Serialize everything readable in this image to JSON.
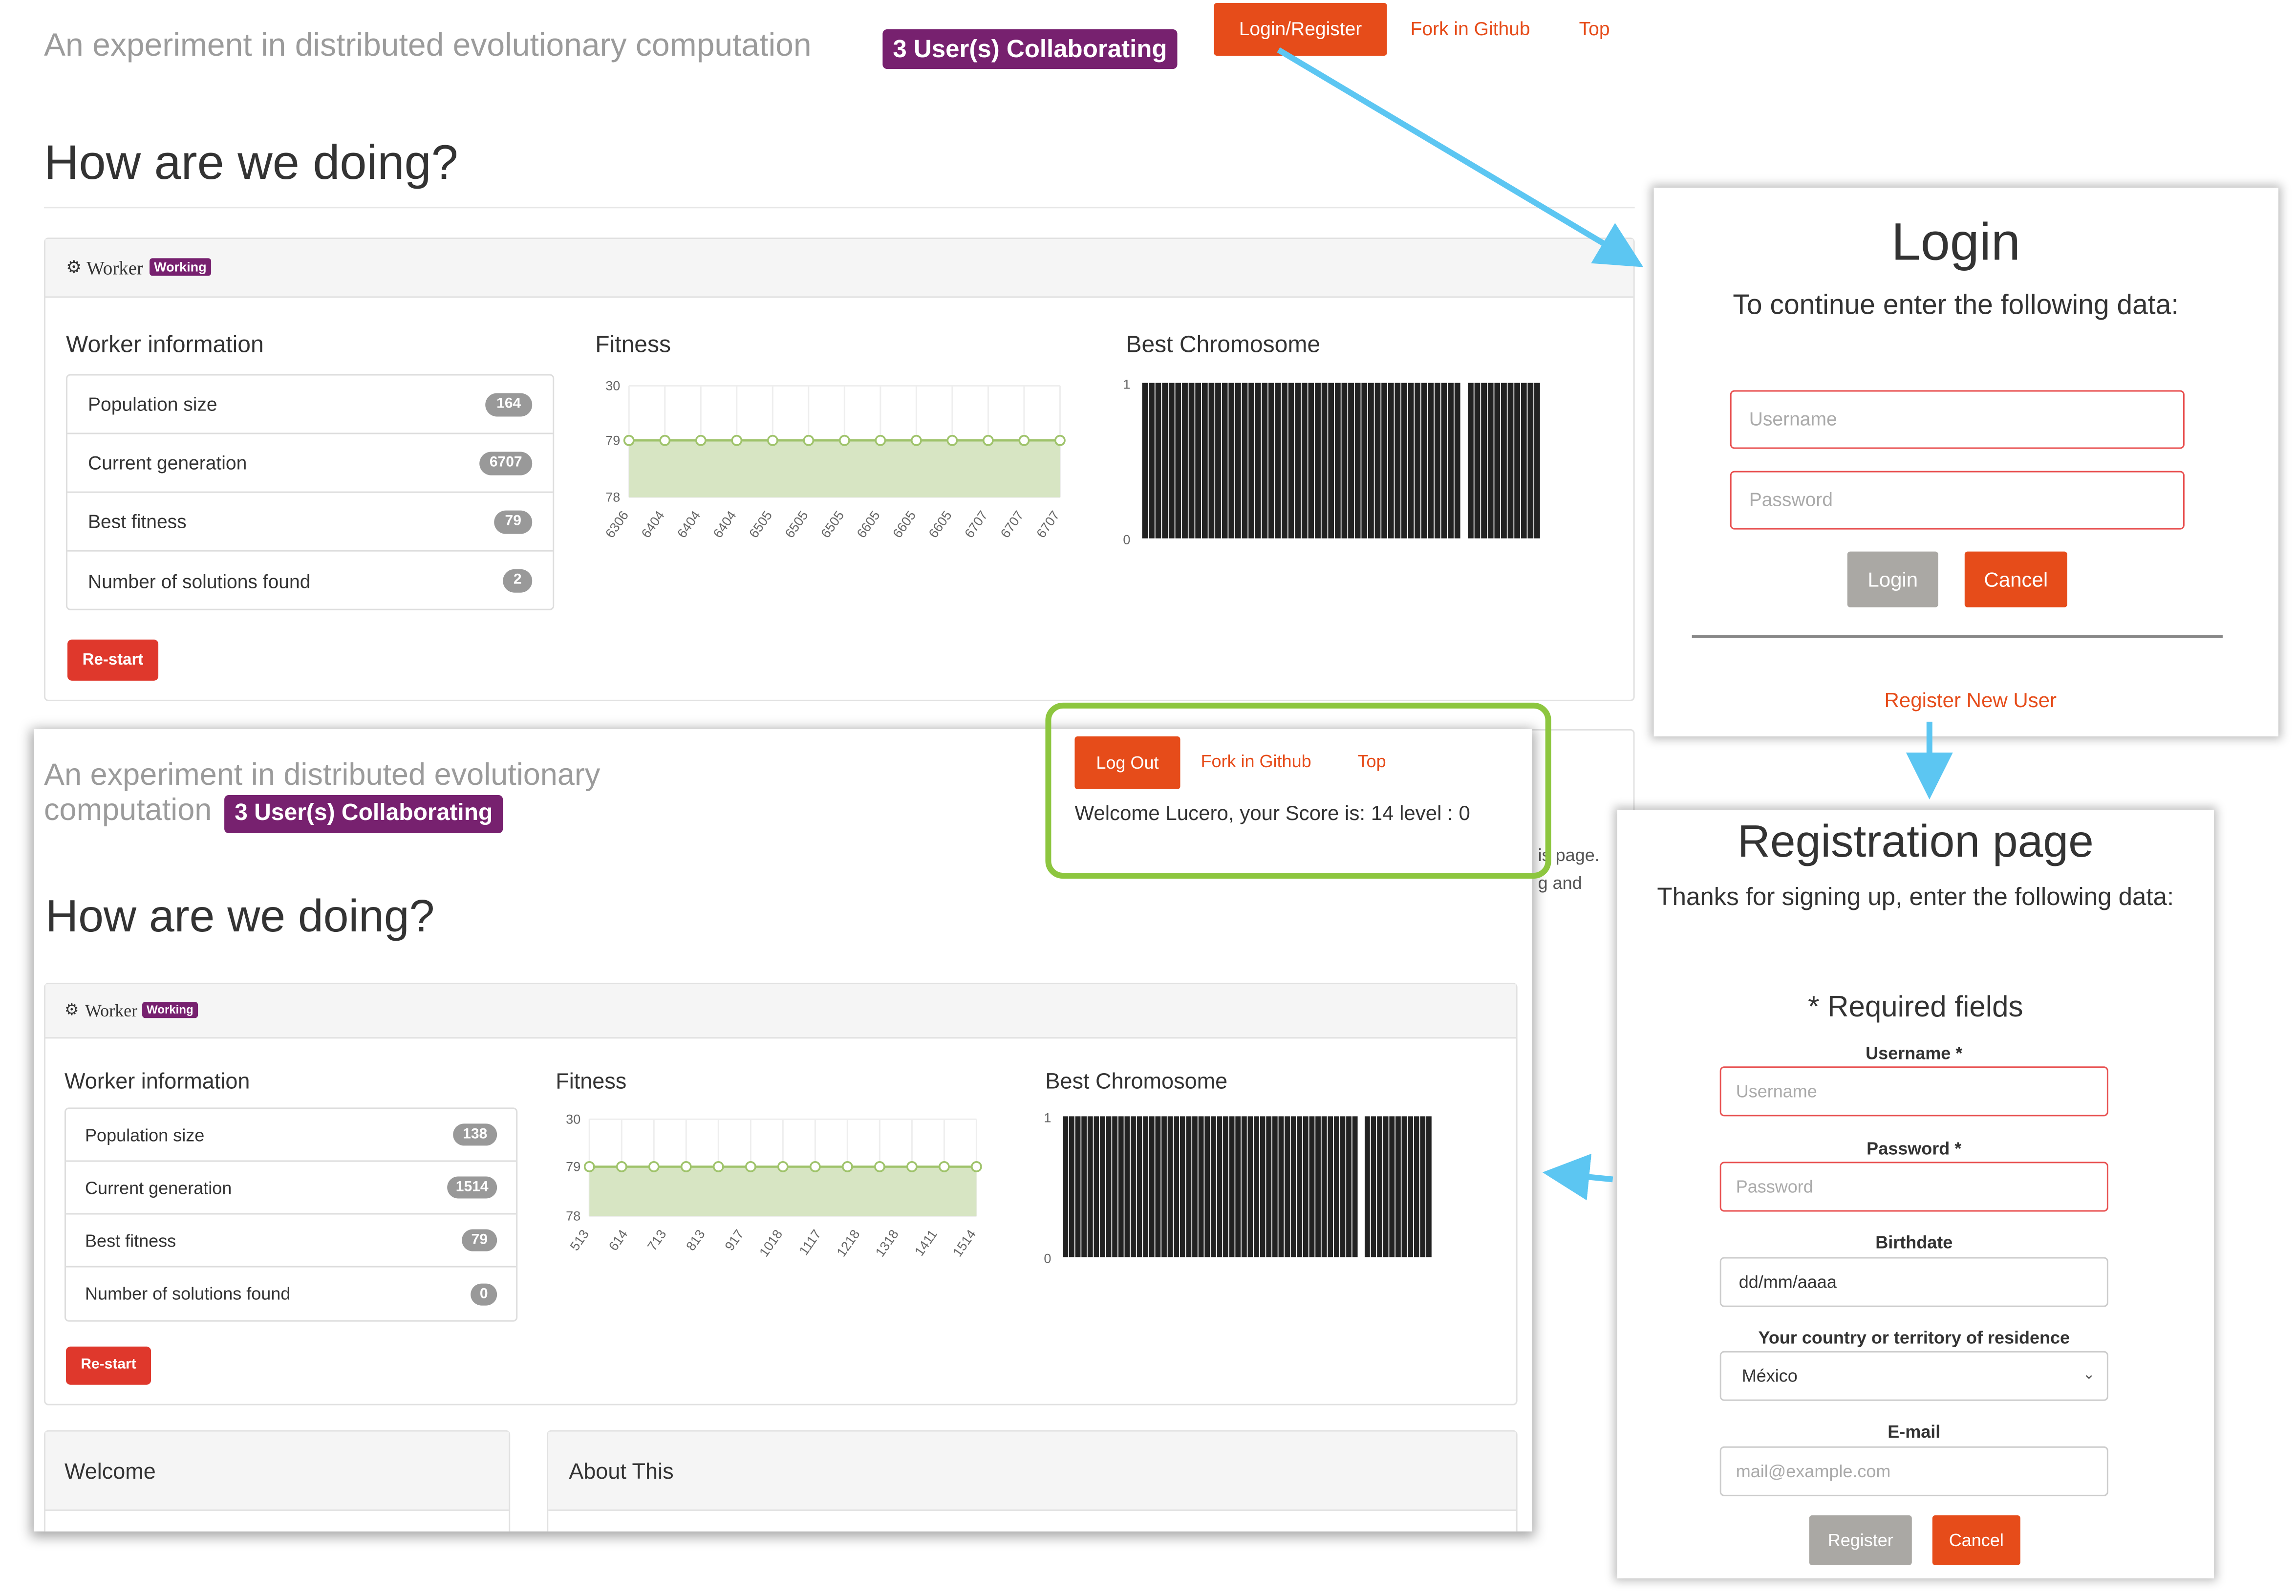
{
  "top": {
    "title": "An experiment in distributed evolutionary computation",
    "collab_badge": "3 User(s) Collaborating",
    "nav": {
      "login_register": "Login/Register",
      "fork": "Fork in Github",
      "top": "Top"
    },
    "heading": "How are we doing?",
    "worker_label": "Worker",
    "working_badge": "Working",
    "worker_info_title": "Worker information",
    "rows": [
      {
        "label": "Population size",
        "value": "164"
      },
      {
        "label": "Current generation",
        "value": "6707"
      },
      {
        "label": "Best fitness",
        "value": "79"
      },
      {
        "label": "Number of solutions found",
        "value": "2"
      }
    ],
    "restart": "Re-start",
    "fitness_title": "Fitness",
    "chromosome_title": "Best Chromosome"
  },
  "bottom": {
    "title_line1": "An experiment in distributed evolutionary",
    "title_line2": "computation",
    "collab_badge": "3 User(s) Collaborating",
    "nav": {
      "logout": "Log Out",
      "fork": "Fork in Github",
      "top": "Top"
    },
    "welcome_text": "Welcome Lucero, your Score is: 14 level : 0",
    "heading": "How are we doing?",
    "worker_label": "Worker",
    "working_badge": "Working",
    "worker_info_title": "Worker information",
    "rows": [
      {
        "label": "Population size",
        "value": "138"
      },
      {
        "label": "Current generation",
        "value": "1514"
      },
      {
        "label": "Best fitness",
        "value": "79"
      },
      {
        "label": "Number of solutions found",
        "value": "0"
      }
    ],
    "restart": "Re-start",
    "fitness_title": "Fitness",
    "chromosome_title": "Best Chromosome",
    "welcome_panel": "Welcome",
    "about_panel": "About This",
    "peek_line1": "is page.",
    "peek_line2": "g and"
  },
  "login": {
    "title": "Login",
    "subtitle": "To continue enter the following data:",
    "username_placeholder": "Username",
    "password_placeholder": "Password",
    "login_button": "Login",
    "cancel_button": "Cancel",
    "register_link": "Register New User"
  },
  "registration": {
    "title": "Registration page",
    "subtitle": "Thanks for signing up, enter the following data:",
    "required_note": "* Required fields",
    "username_label": "Username *",
    "username_placeholder": "Username",
    "password_label": "Password *",
    "password_placeholder": "Password",
    "birthdate_label": "Birthdate",
    "birthdate_value": "dd/mm/aaaa",
    "country_label": "Your country or territory of residence",
    "country_value": "México",
    "email_label": "E-mail",
    "email_placeholder": "mail@example.com",
    "register_button": "Register",
    "cancel_button": "Cancel"
  },
  "chart_data": [
    {
      "type": "line",
      "title": "Fitness",
      "x": [
        "6306",
        "6404",
        "6404",
        "6404",
        "6505",
        "6505",
        "6505",
        "6605",
        "6605",
        "6605",
        "6707",
        "6707",
        "6707"
      ],
      "y_ticks": [
        "30",
        "79",
        "78"
      ],
      "series": [
        {
          "values": [
            79,
            79,
            79,
            79,
            79,
            79,
            79,
            79,
            79,
            79,
            79,
            79,
            79
          ]
        }
      ]
    },
    {
      "type": "bar",
      "title": "Best Chromosome",
      "y_ticks": [
        "1",
        "0"
      ],
      "values": [
        1,
        1,
        1,
        1,
        1,
        1,
        1,
        1,
        1,
        1,
        1,
        1,
        1,
        1,
        1,
        1,
        1,
        1,
        1,
        1,
        1,
        1,
        1,
        1,
        1,
        1,
        1,
        1,
        1,
        1,
        1,
        1,
        1,
        1,
        1,
        1,
        1,
        1,
        1,
        1,
        1,
        1,
        1,
        1,
        1,
        1,
        1,
        1,
        0,
        1,
        1,
        1,
        1,
        1,
        1,
        1,
        1,
        1,
        1,
        1
      ]
    },
    {
      "type": "line",
      "title": "Fitness",
      "x": [
        "513",
        "614",
        "713",
        "813",
        "917",
        "1018",
        "1117",
        "1218",
        "1318",
        "1411",
        "1514"
      ],
      "y_ticks": [
        "30",
        "79",
        "78"
      ],
      "series": [
        {
          "values": [
            79,
            79,
            79,
            79,
            79,
            79,
            79,
            79,
            79,
            79,
            79,
            79,
            79
          ]
        }
      ]
    },
    {
      "type": "bar",
      "title": "Best Chromosome",
      "y_ticks": [
        "1",
        "0"
      ],
      "values": [
        1,
        1,
        1,
        1,
        1,
        1,
        1,
        1,
        1,
        1,
        1,
        1,
        1,
        1,
        1,
        1,
        1,
        1,
        1,
        1,
        1,
        1,
        1,
        1,
        1,
        1,
        1,
        1,
        1,
        1,
        1,
        1,
        1,
        1,
        1,
        1,
        1,
        1,
        1,
        1,
        1,
        1,
        1,
        1,
        1,
        1,
        1,
        1,
        0,
        1,
        1,
        1,
        1,
        1,
        1,
        1,
        1,
        1,
        1,
        1
      ]
    }
  ],
  "colors": {
    "brand_orange": "#e64c1a",
    "aubergine": "#77216f",
    "restart_red": "#df382c",
    "arrow_blue": "#5cc6f2",
    "highlight_green": "#8dc63f",
    "fitness_fill": "#d7e5c3"
  }
}
